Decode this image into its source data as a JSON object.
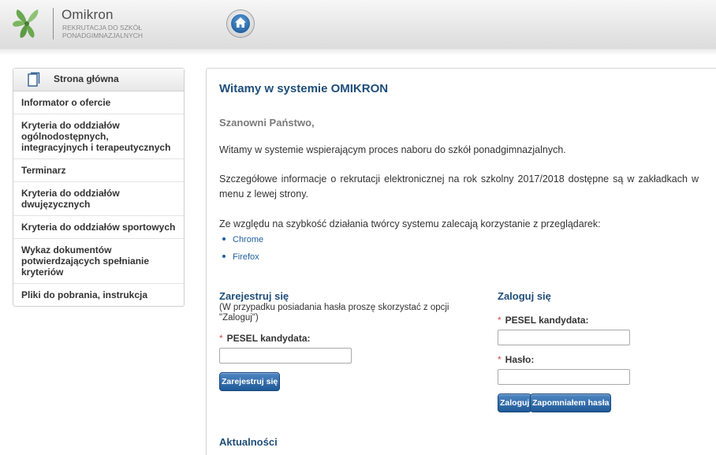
{
  "header": {
    "app_title": "Omikron",
    "app_subtitle": "REKRUTACJA DO SZKÓŁ PONADGIMNAZJALNYCH"
  },
  "sidebar": {
    "title": "Strona główna",
    "items": [
      {
        "label": "Informator o ofercie"
      },
      {
        "label": "Kryteria do oddziałów ogólnodostępnych, integracyjnych i terapeutycznych"
      },
      {
        "label": "Terminarz"
      },
      {
        "label": "Kryteria do oddziałów dwujęzycznych"
      },
      {
        "label": "Kryteria do oddziałów sportowych"
      },
      {
        "label": "Wykaz dokumentów potwierdzających spełnianie kryteriów"
      },
      {
        "label": "Pliki do pobrania, instrukcja"
      }
    ]
  },
  "main": {
    "title": "Witamy w systemie OMIKRON",
    "greeting": "Szanowni Państwo,",
    "paragraph1": "Witamy w systemie wspierającym proces naboru do szkół ponadgimnazjalnych.",
    "paragraph2": "Szczegółowe informacje o rekrutacji elektronicznej na rok szkolny 2017/2018 dostępne są w zakładkach w menu z lewej strony.",
    "paragraph3": "Ze względu na szybkość działania twórcy systemu zalecają korzystanie z przeglądarek:",
    "browsers": [
      "Chrome",
      "Firefox"
    ]
  },
  "register": {
    "title": "Zarejestruj się",
    "note": "(W przypadku posiadania hasła proszę skorzystać z opcji \"Zaloguj\")",
    "pesel_label": "PESEL kandydata:",
    "pesel_value": "",
    "button": "Zarejestruj się"
  },
  "login": {
    "title": "Zaloguj się",
    "pesel_label": "PESEL kandydata:",
    "pesel_value": "",
    "password_label": "Hasło:",
    "password_value": "",
    "button": "Zaloguj",
    "forgot_button": "Zapomniałem hasła"
  },
  "news": {
    "title": "Aktualności"
  },
  "required_mark": "*",
  "colors": {
    "heading_blue": "#1f4e79",
    "link_blue": "#1f5f9e",
    "button_blue": "#2a66a8",
    "required_red": "#d24b4b",
    "logo_green": "#6aa84f"
  },
  "icons": [
    "logo-leaf-icon",
    "home-icon",
    "document-icon"
  ]
}
